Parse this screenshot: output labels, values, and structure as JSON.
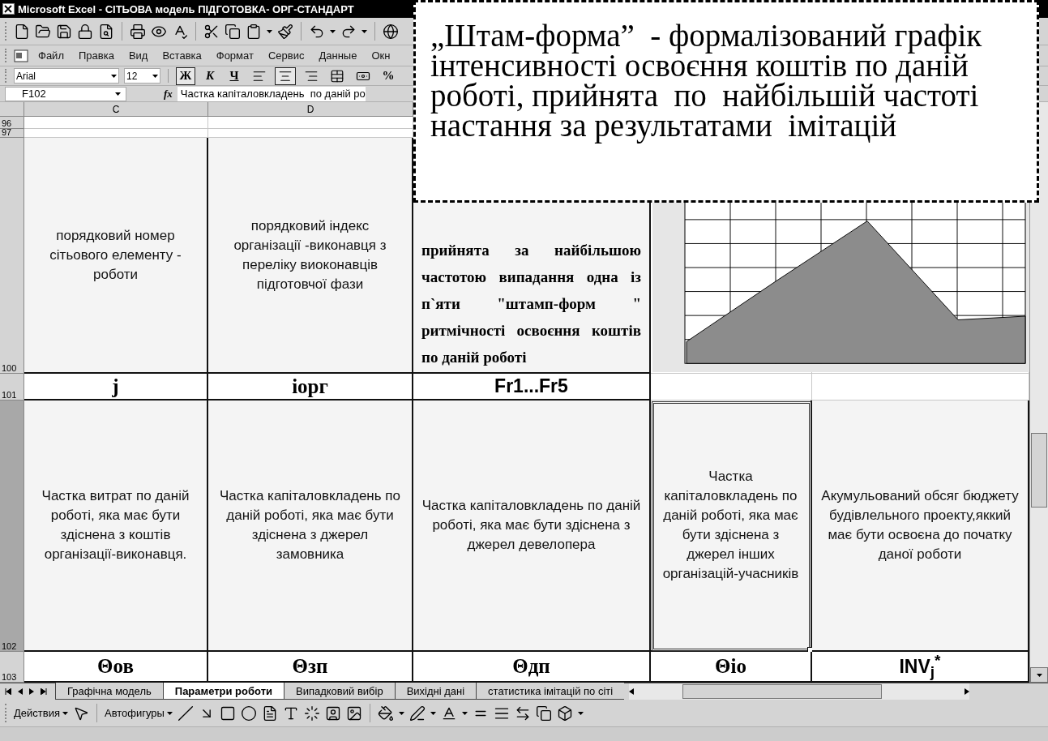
{
  "window": {
    "title": "Microsoft Excel - СІТЬОВА модель ПІДГОТОВКА- ОРГ-СТАНДАРТ"
  },
  "menu": [
    "Файл",
    "Правка",
    "Вид",
    "Вставка",
    "Формат",
    "Сервис",
    "Данные",
    "Окн"
  ],
  "formatting": {
    "font": "Arial",
    "size": "12",
    "buttons": [
      {
        "kind": "text",
        "label": "Ж",
        "pressed": true
      },
      {
        "kind": "italic",
        "label": "К",
        "pressed": false
      },
      {
        "kind": "underline",
        "label": "Ч",
        "pressed": false
      },
      {
        "kind": "align-left",
        "pressed": false
      },
      {
        "kind": "align-center",
        "pressed": true
      },
      {
        "kind": "align-right",
        "pressed": false
      },
      {
        "kind": "merge",
        "pressed": false
      },
      {
        "kind": "currency",
        "pressed": false
      },
      {
        "kind": "text",
        "label": "%",
        "pressed": false
      }
    ]
  },
  "formula_bar": {
    "cell": "F102",
    "fx": "fx",
    "value": "Частка капіталовкладень  по даній ро"
  },
  "columns": [
    "C",
    "D"
  ],
  "rows": [
    {
      "number": "96"
    },
    {
      "number": "97"
    },
    {
      "number": "100",
      "cells": [
        {
          "kind": "caption",
          "text": "порядковий номер сітьового елементу - роботи",
          "selected": false
        },
        {
          "kind": "caption",
          "text": "порядковий індекс організації -виконавця з переліку виоконавців підготовчої фази",
          "selected": false
        },
        {
          "kind": "note",
          "text": "прийнята за найбільшою частотою випадання одна із п`яти \"штамп-форм \" ритмічності освоєння коштів по даній роботі",
          "selected": false
        }
      ]
    },
    {
      "number": "101",
      "cells": [
        {
          "kind": "symbol",
          "text": "j",
          "selected": false
        },
        {
          "kind": "symbol",
          "text": "iорг",
          "selected": false
        },
        {
          "kind": "code",
          "text": "Fr1...Fr5",
          "selected": false
        }
      ]
    },
    {
      "number": "102",
      "cells": [
        {
          "kind": "caption",
          "text": "Частка витрат  по даній роботі, яка має  бути здіснена з коштів організації-виконавця.",
          "selected": false
        },
        {
          "kind": "caption",
          "text": "Частка капіталовкладень  по даній роботі, яка має бути здіснена з джерел замовника",
          "selected": false
        },
        {
          "kind": "caption",
          "text": "Частка капіталовкладень по даній роботі, яка має бути здіснена з джерел девелопера",
          "selected": false
        },
        {
          "kind": "caption",
          "text": "Частка капіталовкладень  по даній роботі, яка має бути здіснена з джерел інших організацій-учасників",
          "selected": true
        },
        {
          "kind": "caption",
          "text": "Акумульований обсяг бюджету будівлельного проекту,яккий має бути освоєна  до початку  даної роботи",
          "selected": false
        }
      ]
    },
    {
      "number": "103",
      "cells": [
        {
          "kind": "symbol",
          "text": "Θов",
          "selected": false
        },
        {
          "kind": "symbol",
          "text": "Θзп",
          "selected": false
        },
        {
          "kind": "symbol",
          "text": "Θдп",
          "selected": false
        },
        {
          "kind": "symbol",
          "text": "Θio",
          "selected": false
        },
        {
          "kind": "code",
          "text": "INV$_{j}$$^{*}$",
          "selected": false
        }
      ]
    }
  ],
  "sheet_tabs": [
    {
      "label": "Графічна модель",
      "selected": false
    },
    {
      "label": "Параметри роботи",
      "selected": true
    },
    {
      "label": "Випадковий вибір",
      "selected": false
    },
    {
      "label": "Вихідні дані",
      "selected": false
    },
    {
      "label": "статистика імітацій по сіті",
      "selected": false
    }
  ],
  "drawing_toolbar": {
    "actions": "Действия",
    "autoshapes": "Автофигуры"
  },
  "callout": {
    "text": "„Штам-форма”  - формалізований графік інтенсивності освоєння коштів по даній роботі, прийнята  по  найбільшій частоті настання за результатами  імітацій"
  }
}
